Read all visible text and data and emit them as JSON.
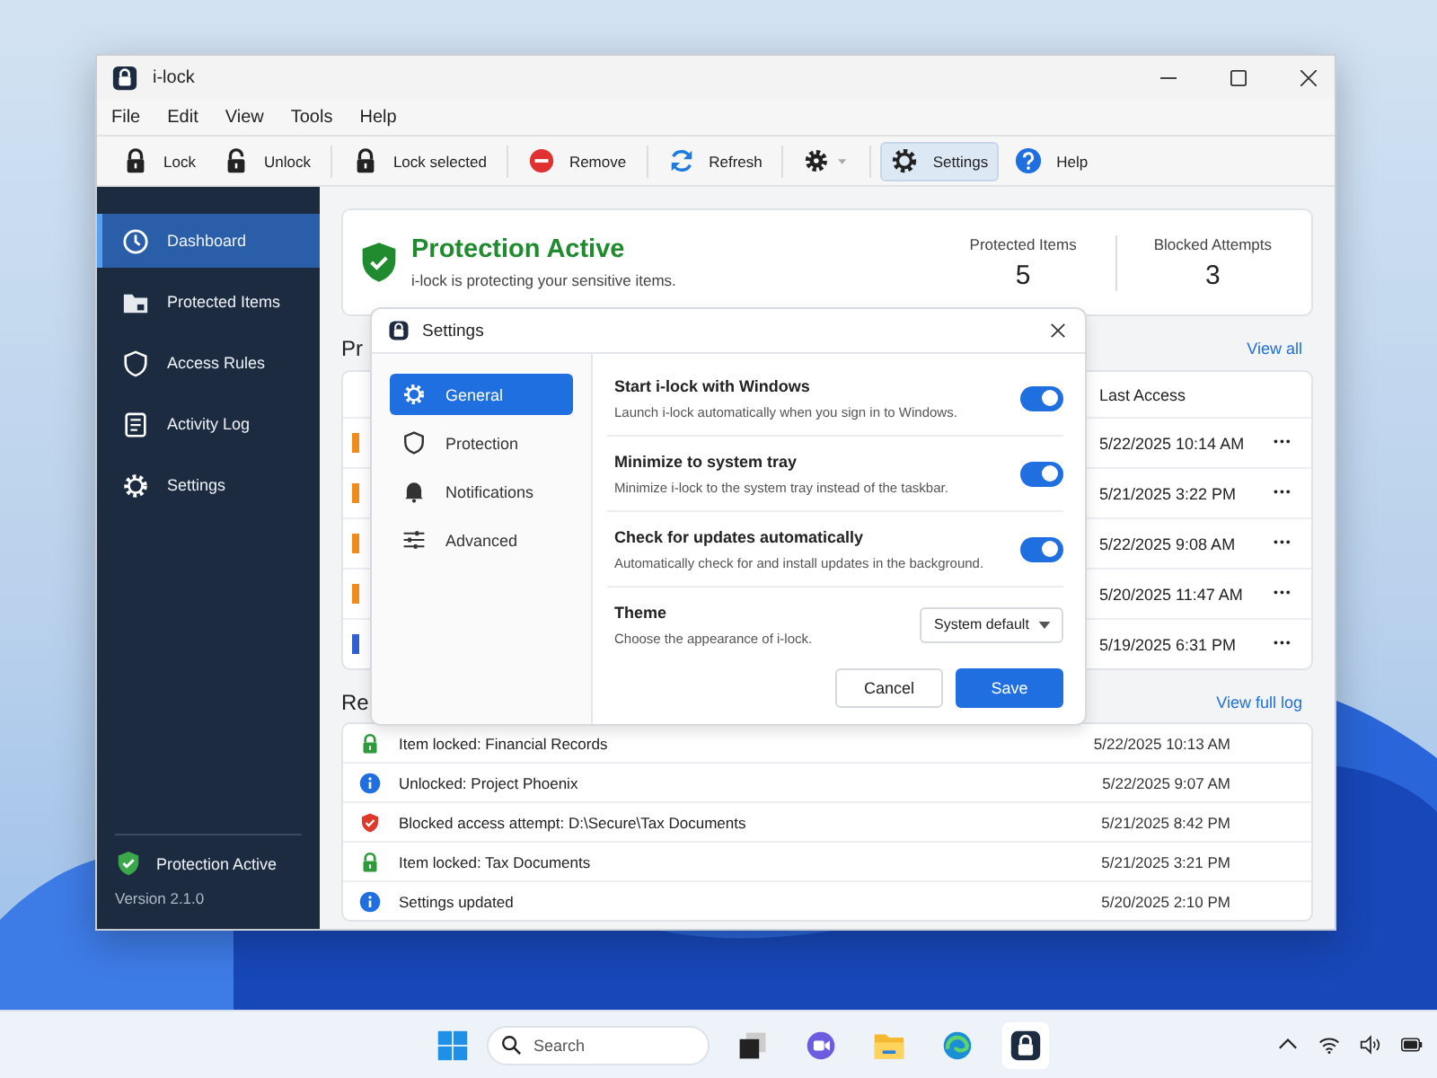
{
  "window": {
    "title": "i-lock"
  },
  "menu": [
    "File",
    "Edit",
    "View",
    "Tools",
    "Help"
  ],
  "toolbar": [
    [
      {
        "label": "Lock",
        "kind": "lock",
        "selected": false
      },
      {
        "label": "Unlock",
        "kind": "unlock",
        "selected": false
      }
    ],
    [
      {
        "label": "Lock selected",
        "kind": "lock",
        "selected": false
      }
    ],
    [
      {
        "label": "Remove",
        "kind": "remove",
        "selected": false
      }
    ],
    [
      {
        "label": "Refresh",
        "kind": "refresh",
        "selected": false
      }
    ],
    [
      {
        "kind": "gear-menu",
        "selected": false
      }
    ],
    [
      {
        "label": "Settings",
        "kind": "gear",
        "selected": true
      },
      {
        "label": "Help",
        "kind": "help",
        "selected": false
      }
    ]
  ],
  "sidebar": {
    "items": [
      {
        "label": "Dashboard",
        "kind": "clock",
        "selected": true
      },
      {
        "label": "Protected Items",
        "kind": "folder",
        "selected": false
      },
      {
        "label": "Access Rules",
        "kind": "shield",
        "selected": false
      },
      {
        "label": "Activity Log",
        "kind": "document",
        "selected": false
      },
      {
        "label": "Settings",
        "kind": "gear",
        "selected": false
      }
    ],
    "status": "Protection Active",
    "version": "Version 2.1.0"
  },
  "status_card": {
    "title": "Protection Active",
    "subtitle": "i-lock is protecting your sensitive items.",
    "stats": [
      {
        "label": "Protected Items",
        "value": "5"
      },
      {
        "label": "Blocked Attempts",
        "value": "3"
      }
    ]
  },
  "items_section": {
    "heading": "Pr",
    "link": "View all",
    "column": "Last Access",
    "rows": [
      {
        "color": "#f08c1e",
        "last_access": "5/22/2025 10:14 AM",
        "actions": "•••"
      },
      {
        "color": "#f08c1e",
        "last_access": "5/21/2025 3:22 PM",
        "actions": "•••"
      },
      {
        "color": "#f08c1e",
        "last_access": "5/22/2025 9:08 AM",
        "actions": "•••"
      },
      {
        "color": "#f08c1e",
        "last_access": "5/20/2025 11:47 AM",
        "actions": "•••"
      },
      {
        "color": "#2f5fd0",
        "last_access": "5/19/2025 6:31 PM",
        "actions": "•••"
      }
    ]
  },
  "activity": {
    "heading": "Re",
    "link": "View full log",
    "entries": [
      {
        "kind": "lock",
        "text": "Item locked:  Financial Records",
        "time": "5/22/2025 10:13 AM"
      },
      {
        "kind": "info",
        "text": "Unlocked:  Project Phoenix",
        "time": "5/22/2025 9:07 AM"
      },
      {
        "kind": "blocked",
        "text": "Blocked access attempt:  D:\\Secure\\Tax Documents",
        "time": "5/21/2025 8:42 PM"
      },
      {
        "kind": "lock",
        "text": "Item locked:  Tax Documents",
        "time": "5/21/2025 3:21 PM"
      },
      {
        "kind": "info",
        "text": "Settings updated",
        "time": "5/20/2025 2:10 PM"
      }
    ]
  },
  "dialog": {
    "title": "Settings",
    "nav": [
      {
        "label": "General",
        "kind": "gear",
        "selected": true
      },
      {
        "label": "Protection",
        "kind": "shield",
        "selected": false
      },
      {
        "label": "Notifications",
        "kind": "bell",
        "selected": false
      },
      {
        "label": "Advanced",
        "kind": "sliders",
        "selected": false
      }
    ],
    "settings": [
      {
        "kind": "toggle",
        "title": "Start i-lock with Windows",
        "description": "Launch i-lock automatically when you sign in to Windows.",
        "on": true
      },
      {
        "kind": "toggle",
        "title": "Minimize to system tray",
        "description": "Minimize i-lock to the system tray instead of the taskbar.",
        "on": true
      },
      {
        "kind": "toggle",
        "title": "Check for updates automatically",
        "description": "Automatically check for and install updates in the background.",
        "on": true
      },
      {
        "kind": "select",
        "title": "Theme",
        "description": "Choose the appearance of i-lock.",
        "value": "System default"
      }
    ],
    "buttons": [
      {
        "label": "Cancel",
        "kind": "secondary"
      },
      {
        "label": "Save",
        "kind": "primary"
      }
    ]
  },
  "taskbar": {
    "search": {
      "placeholder": "Search"
    },
    "apps": [
      {
        "kind": "task-view",
        "selected": false
      },
      {
        "kind": "chat",
        "selected": false
      },
      {
        "kind": "explorer",
        "selected": false
      },
      {
        "kind": "edge",
        "selected": false
      },
      {
        "kind": "i-lock",
        "selected": true
      }
    ]
  }
}
